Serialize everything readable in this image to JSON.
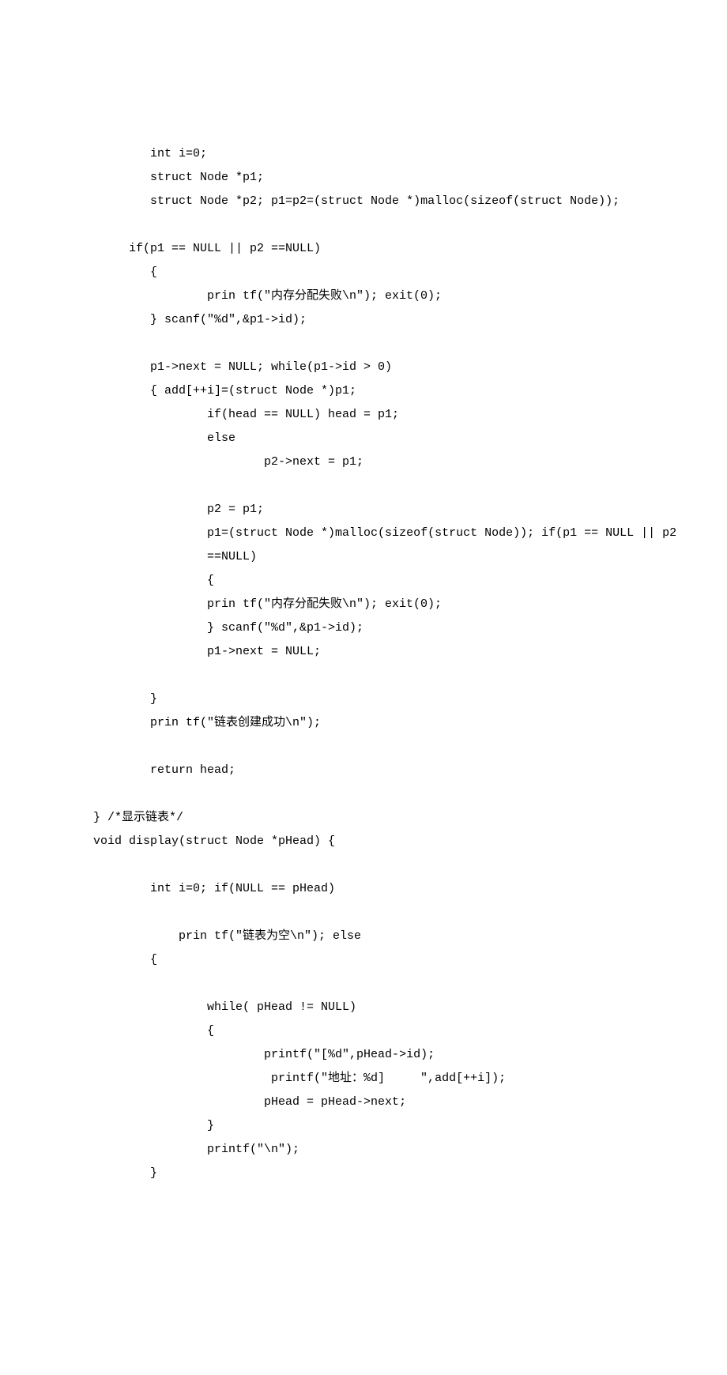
{
  "lines": [
    "        int i=0;",
    "        struct Node *p1;",
    "        struct Node *p2; p1=p2=(struct Node *)malloc(sizeof(struct Node));",
    "",
    "     if(p1 == NULL || p2 ==NULL)",
    "        {",
    "                prin tf(\"内存分配失败\\n\"); exit(0);",
    "        } scanf(\"%d\",&p1->id);",
    "",
    "        p1->next = NULL; while(p1->id > 0)",
    "        { add[++i]=(struct Node *)p1;",
    "                if(head == NULL) head = p1;",
    "                else",
    "                        p2->next = p1;",
    "",
    "                p2 = p1;",
    "                p1=(struct Node *)malloc(sizeof(struct Node)); if(p1 == NULL || p2 ",
    "                ==NULL)",
    "                {",
    "                prin tf(\"内存分配失败\\n\"); exit(0);",
    "                } scanf(\"%d\",&p1->id);",
    "                p1->next = NULL;",
    "",
    "        }",
    "        prin tf(\"链表创建成功\\n\");",
    "",
    "        return head;",
    "",
    "} /*显示链表*/",
    "void display(struct Node *pHead) {",
    "",
    "        int i=0; if(NULL == pHead)",
    "",
    "            prin tf(\"链表为空\\n\"); else",
    "        {",
    "",
    "                while( pHead != NULL)",
    "                {",
    "                        printf(\"[%d\",pHead->id);",
    "                         printf(\"地址：%d]     \",add[++i]);",
    "                        pHead = pHead->next;",
    "                }",
    "                printf(\"\\n\");",
    "        }"
  ]
}
